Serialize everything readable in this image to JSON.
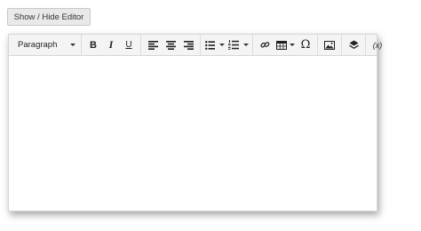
{
  "toggle_button": {
    "label": "Show / Hide Editor"
  },
  "toolbar": {
    "format_select": {
      "value": "Paragraph"
    },
    "bold": {
      "glyph": "B"
    },
    "italic": {
      "glyph": "I"
    },
    "underline": {
      "glyph": "U"
    },
    "special_char": {
      "glyph": "Ω"
    },
    "formula": {
      "glyph": "(x)"
    }
  },
  "icons": {
    "bold": "bold-icon",
    "italic": "italic-icon",
    "underline": "underline-icon",
    "align_left": "align-left-icon",
    "align_center": "align-center-icon",
    "align_right": "align-right-icon",
    "bullet_list": "bullet-list-icon",
    "numbered_list": "numbered-list-icon",
    "link": "link-icon",
    "table": "table-icon",
    "special_char": "omega-icon",
    "image": "image-icon",
    "layer": "layer-icon",
    "formula": "formula-icon"
  },
  "content": {
    "text": ""
  }
}
